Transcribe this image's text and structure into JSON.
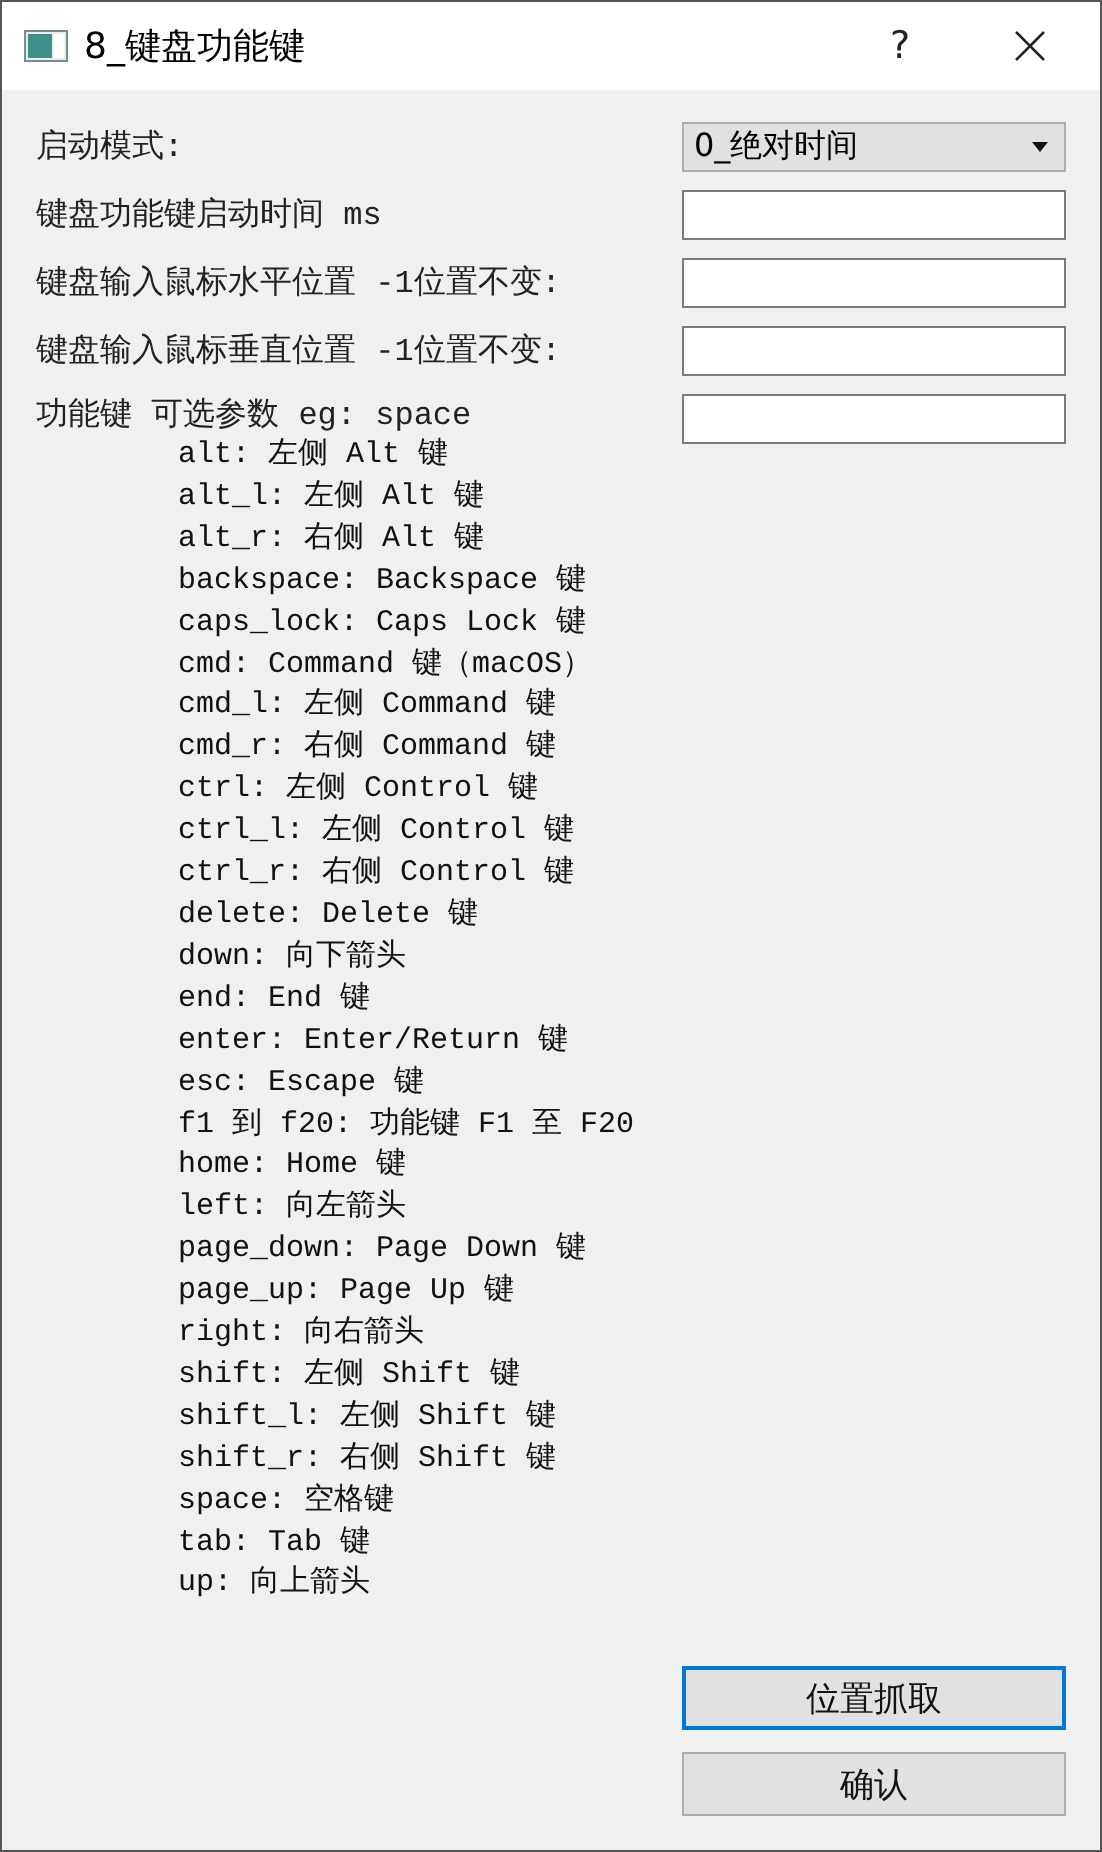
{
  "window": {
    "title": "8_键盘功能键",
    "help": "?"
  },
  "form": [
    {
      "kind": "combo",
      "label": "启动模式:",
      "value": "0_绝对时间"
    },
    {
      "kind": "input",
      "label": "键盘功能键启动时间 ms"
    },
    {
      "kind": "input",
      "label": "键盘输入鼠标水平位置 -1位置不变:"
    },
    {
      "kind": "input",
      "label": "键盘输入鼠标垂直位置 -1位置不变:"
    }
  ],
  "keys_field": {
    "heading": "功能键 可选参数 eg: space",
    "lines": [
      "alt: 左侧 Alt 键",
      "alt_l: 左侧 Alt 键",
      "alt_r: 右侧 Alt 键",
      "backspace: Backspace 键",
      "caps_lock: Caps Lock 键",
      "cmd: Command 键（macOS）",
      "cmd_l: 左侧 Command 键",
      "cmd_r: 右侧 Command 键",
      "ctrl: 左侧 Control 键",
      "ctrl_l: 左侧 Control 键",
      "ctrl_r: 右侧 Control 键",
      "delete: Delete 键",
      "down: 向下箭头",
      "end: End 键",
      "enter: Enter/Return 键",
      "esc: Escape 键",
      "f1 到 f20: 功能键 F1 至 F20",
      "home: Home 键",
      "left: 向左箭头",
      "page_down: Page Down 键",
      "page_up: Page Up 键",
      "right: 向右箭头",
      "shift: 左侧 Shift 键",
      "shift_l: 左侧 Shift 键",
      "shift_r: 右侧 Shift 键",
      "space: 空格键",
      "tab: Tab 键",
      "up: 向上箭头"
    ]
  },
  "buttons": [
    {
      "label": "位置抓取",
      "focused": true
    },
    {
      "label": "确认",
      "focused": false
    }
  ]
}
